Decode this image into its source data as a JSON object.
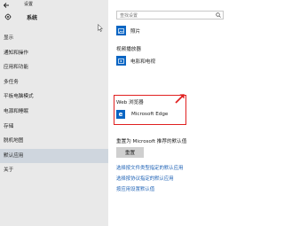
{
  "window": {
    "title": "设置"
  },
  "sidebar": {
    "header": "系统",
    "items": [
      {
        "label": "显示"
      },
      {
        "label": "通知和操作"
      },
      {
        "label": "应用和功能"
      },
      {
        "label": "多任务"
      },
      {
        "label": "平板电脑模式"
      },
      {
        "label": "电源和睡眠"
      },
      {
        "label": "存储"
      },
      {
        "label": "脱机地图"
      },
      {
        "label": "默认应用",
        "active": true
      },
      {
        "label": "关于"
      }
    ]
  },
  "search": {
    "placeholder": "查找设置"
  },
  "main": {
    "photo_app": "照片",
    "video_section": "视频播放器",
    "video_app": "电影和电视",
    "web_section": "Web 浏览器",
    "web_app": "Microsoft Edge",
    "reset_text": "重置为 Microsoft 推荐的默认值",
    "reset_button": "重置",
    "links": [
      "选择按文件类型指定的默认应用",
      "选择按协议指定的默认应用",
      "按应用设置默认值"
    ]
  },
  "colors": {
    "accent": "#0a65c3",
    "highlight": "#e02020",
    "link": "#1a5fb4",
    "sidebar_bg": "#e9e9e9",
    "active_bg": "#cfd6de"
  },
  "icons": {
    "back": "back-arrow-icon",
    "settings": "gear-icon",
    "search": "search-icon",
    "photos": "photos-icon",
    "video": "video-icon",
    "edge": "edge-icon",
    "annotation": "red-arrow-icon"
  }
}
